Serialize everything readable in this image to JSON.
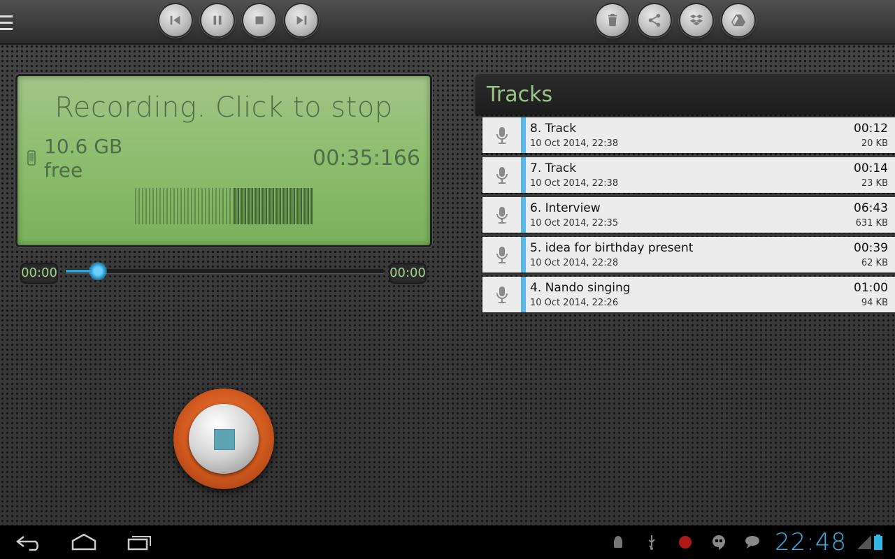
{
  "toolbar": {
    "playback": [
      "rewind-icon",
      "pause-icon",
      "stop-icon",
      "fast-forward-icon"
    ],
    "actions": [
      "trash-icon",
      "share-icon",
      "dropbox-icon",
      "google-drive-icon"
    ]
  },
  "display": {
    "status": "Recording. Click to stop",
    "free_space": "10.6 GB",
    "free_label": "free",
    "elapsed": "00:35:166"
  },
  "seek": {
    "start_time": "00:00",
    "end_time": "00:00",
    "progress": 0.1
  },
  "tracks": {
    "title": "Tracks",
    "items": [
      {
        "name": "8. Track",
        "date": "10 Oct 2014, 22:38",
        "duration": "00:12",
        "size": "20 KB"
      },
      {
        "name": "7. Track",
        "date": "10 Oct 2014, 22:38",
        "duration": "00:14",
        "size": "23 KB"
      },
      {
        "name": "6. Interview",
        "date": "10 Oct 2014, 22:35",
        "duration": "06:43",
        "size": "631 KB"
      },
      {
        "name": "5. idea for birthday present",
        "date": "10 Oct 2014, 22:28",
        "duration": "00:39",
        "size": "62 KB"
      },
      {
        "name": "4. Nando singing",
        "date": "10 Oct 2014, 22:26",
        "duration": "01:00",
        "size": "94 KB"
      }
    ]
  },
  "statusbar": {
    "clock": "22:48"
  },
  "colors": {
    "accent": "#33b5e5",
    "lcd_text": "#4f6e47",
    "record_ring": "#d35a1e",
    "track_marker": "#5ab7e6"
  }
}
